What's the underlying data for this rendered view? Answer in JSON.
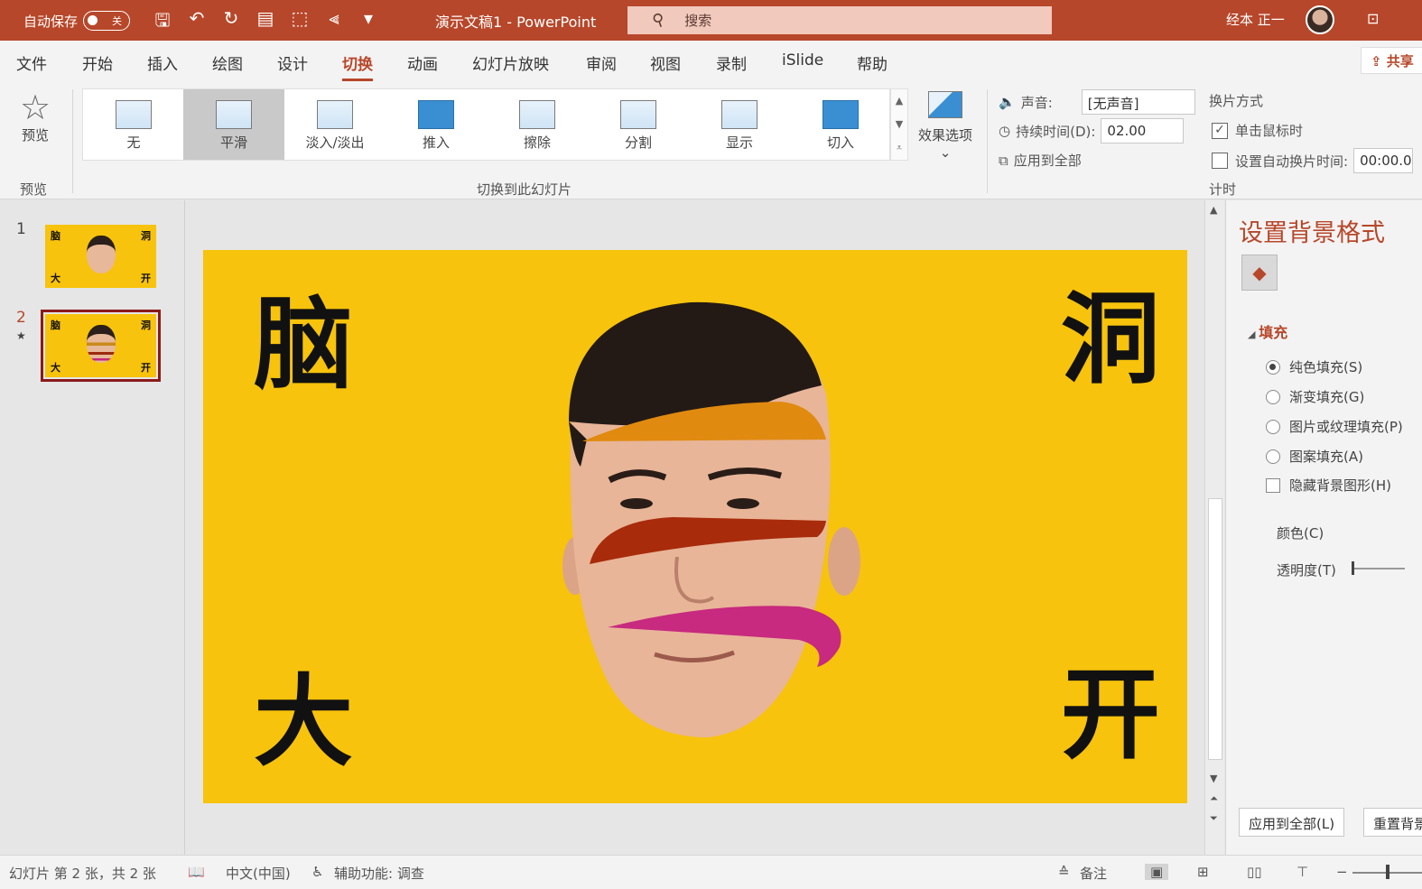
{
  "titlebar": {
    "autosave_label": "自动保存",
    "autosave_state": "关",
    "doc_title": "演示文稿1  -  PowerPoint",
    "search_placeholder": "搜索",
    "user_name": "经本 正一"
  },
  "menu": {
    "tabs": [
      "文件",
      "开始",
      "插入",
      "绘图",
      "设计",
      "切换",
      "动画",
      "幻灯片放映",
      "审阅",
      "视图",
      "录制",
      "iSlide",
      "帮助"
    ],
    "active_tab": "切换",
    "share_label": "共享"
  },
  "ribbon": {
    "preview_label": "预览",
    "preview_group": "预览",
    "transitions": [
      "无",
      "平滑",
      "淡入/淡出",
      "推入",
      "擦除",
      "分割",
      "显示",
      "切入"
    ],
    "selected_transition": "平滑",
    "effect_options": "效果选项",
    "group_transition": "切换到此幻灯片",
    "sound_label": "声音:",
    "sound_value": "[无声音]",
    "duration_label": "持续时间(D):",
    "duration_value": "02.00",
    "apply_all": "应用到全部",
    "advance_title": "换片方式",
    "on_click_label": "单击鼠标时",
    "on_click_checked": true,
    "auto_advance_label": "设置自动换片时间:",
    "auto_advance_value": "00:00.0",
    "group_timing": "计时"
  },
  "thumbnails": [
    {
      "number": "1",
      "chars": [
        "脑",
        "洞",
        "大",
        "开"
      ]
    },
    {
      "number": "2",
      "star": "★",
      "chars": [
        "脑",
        "洞",
        "大",
        "开"
      ],
      "selected": true
    }
  ],
  "slide": {
    "top_left": "脑",
    "top_right": "洞",
    "bottom_left": "大",
    "bottom_right": "开",
    "background_color": "#f7c30c"
  },
  "format_pane": {
    "title": "设置背景格式",
    "section": "填充",
    "options": [
      "纯色填充(S)",
      "渐变填充(G)",
      "图片或纹理填充(P)",
      "图案填充(A)"
    ],
    "selected_option": "纯色填充(S)",
    "hide_bg_graphics": "隐藏背景图形(H)",
    "color_label": "颜色(C)",
    "transparency_label": "透明度(T)",
    "apply_all_button": "应用到全部(L)",
    "reset_button": "重置背景"
  },
  "status": {
    "slide_info": "幻灯片 第 2 张，共 2 张",
    "language": "中文(中国)",
    "accessibility": "辅助功能: 调查",
    "notes": "备注"
  }
}
